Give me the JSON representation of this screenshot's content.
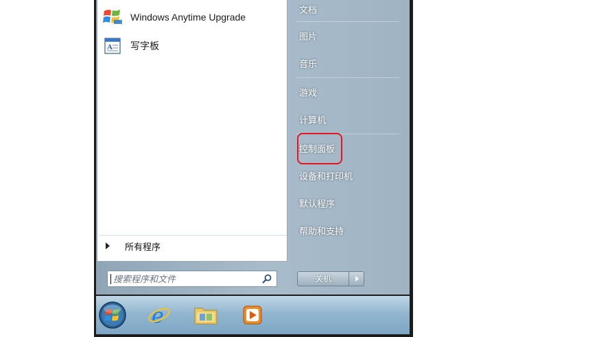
{
  "start_menu": {
    "programs": [
      {
        "label": "Windows Anytime Upgrade",
        "icon": "windows-upgrade-icon"
      },
      {
        "label": "写字板",
        "icon": "wordpad-icon"
      }
    ],
    "all_programs": {
      "label": "所有程序",
      "icon": "triangle-right-icon"
    },
    "search": {
      "placeholder": "搜索程序和文件",
      "icon": "search-icon"
    },
    "right_items": [
      {
        "label": "文档"
      },
      {
        "label": "图片"
      },
      {
        "label": "音乐"
      },
      {
        "label": "游戏"
      },
      {
        "label": "计算机"
      },
      {
        "label": "控制面板",
        "highlighted": true
      },
      {
        "label": "设备和打印机"
      },
      {
        "label": "默认程序"
      },
      {
        "label": "帮助和支持"
      }
    ],
    "shutdown": {
      "label": "关机",
      "more_icon": "triangle-right-icon"
    }
  },
  "taskbar": {
    "items": [
      {
        "icon": "windows-orb-icon"
      },
      {
        "icon": "internet-explorer-icon"
      },
      {
        "icon": "folder-icon"
      },
      {
        "icon": "media-player-icon"
      }
    ]
  },
  "colors": {
    "highlight_ring": "#e2161c",
    "start_menu_bg": "#a9bccb",
    "taskbar": "#93b6cf"
  }
}
